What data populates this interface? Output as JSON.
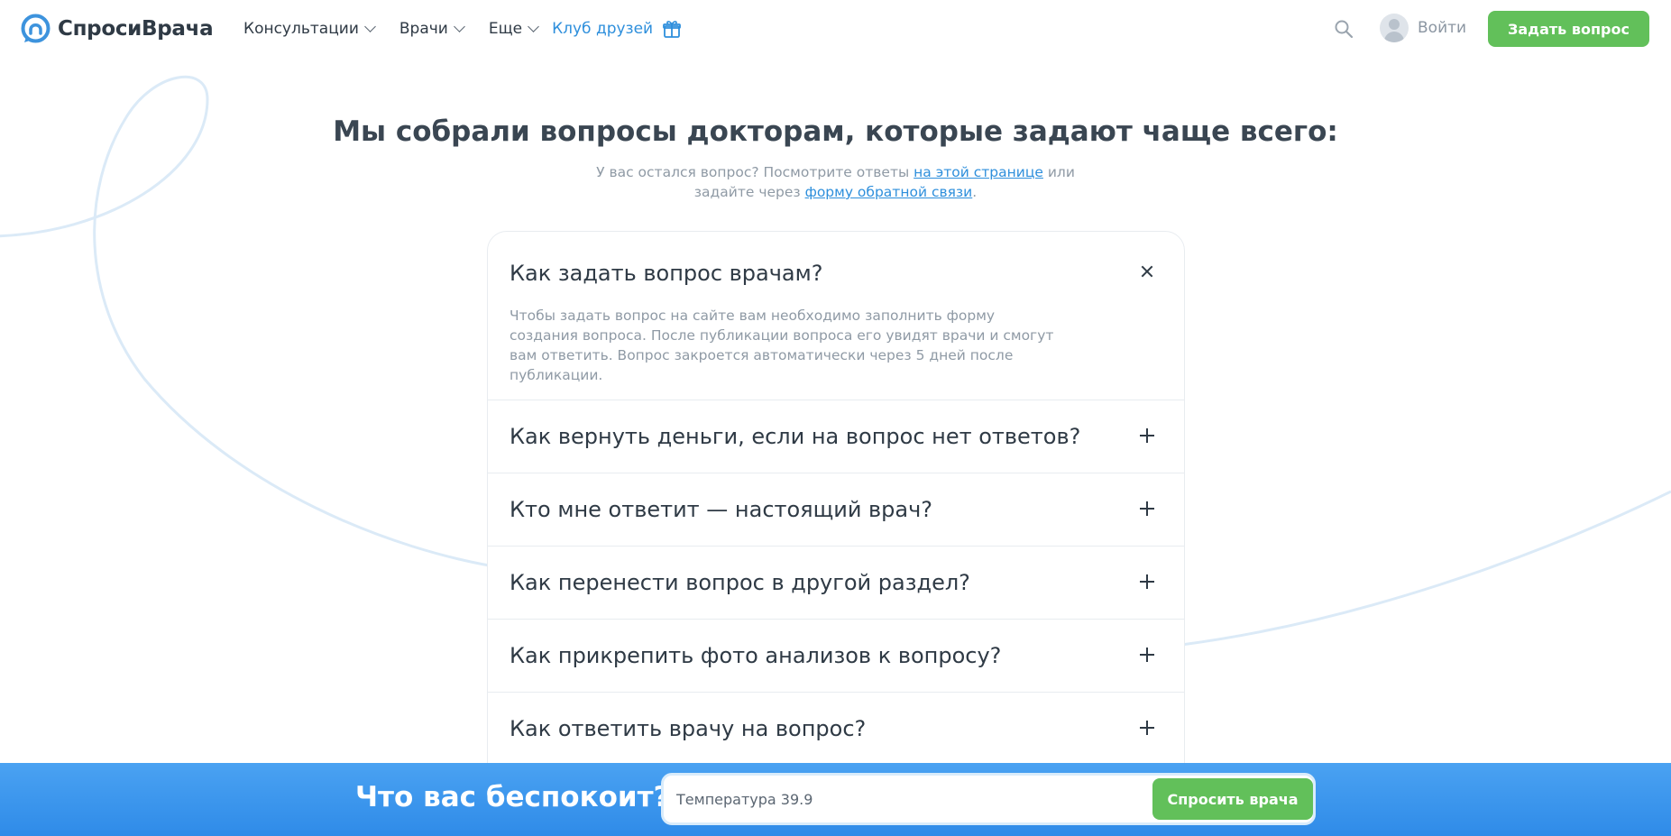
{
  "brand": {
    "name": "СпросиВрача",
    "accent": "#2e8fdc",
    "green": "#62c05a"
  },
  "nav": {
    "items": [
      {
        "label": "Консультации"
      },
      {
        "label": "Врачи"
      },
      {
        "label": "Еще"
      }
    ],
    "club_label": "Клуб друзей",
    "login_label": "Войти",
    "ask_button": "Задать вопрос"
  },
  "main": {
    "title": "Мы собрали вопросы докторам, которые задают чаще всего:",
    "subtitle_part1": "У вас остался вопрос? Посмотрите ответы ",
    "subtitle_link1": "на этой странице",
    "subtitle_part2": " или задайте через ",
    "subtitle_link2": "форму обратной связи",
    "subtitle_part3": "."
  },
  "faq": [
    {
      "question": "Как задать вопрос врачам?",
      "answer": "Чтобы задать вопрос на сайте вам необходимо заполнить форму создания вопроса. После публикации вопроса его увидят врачи и смогут вам ответить. Вопрос закроется автоматически через 5 дней после публикации.",
      "open": true
    },
    {
      "question": "Как вернуть деньги, если на вопрос нет ответов?",
      "open": false
    },
    {
      "question": "Кто мне ответит — настоящий врач?",
      "open": false
    },
    {
      "question": "Как перенести вопрос в другой раздел?",
      "open": false
    },
    {
      "question": "Как прикрепить фото анализов к вопросу?",
      "open": false
    },
    {
      "question": "Как ответить врачу на вопрос?",
      "open": false
    }
  ],
  "bottom_bar": {
    "title": "Что вас беспокоит?",
    "input_placeholder": "Температура 39.9",
    "button_label": "Спросить врача"
  },
  "icons": {
    "logo": "logo-icon",
    "search": "search-icon",
    "gift": "gift-icon",
    "avatar": "user-avatar",
    "expand": "plus-icon",
    "collapse": "close-icon"
  }
}
